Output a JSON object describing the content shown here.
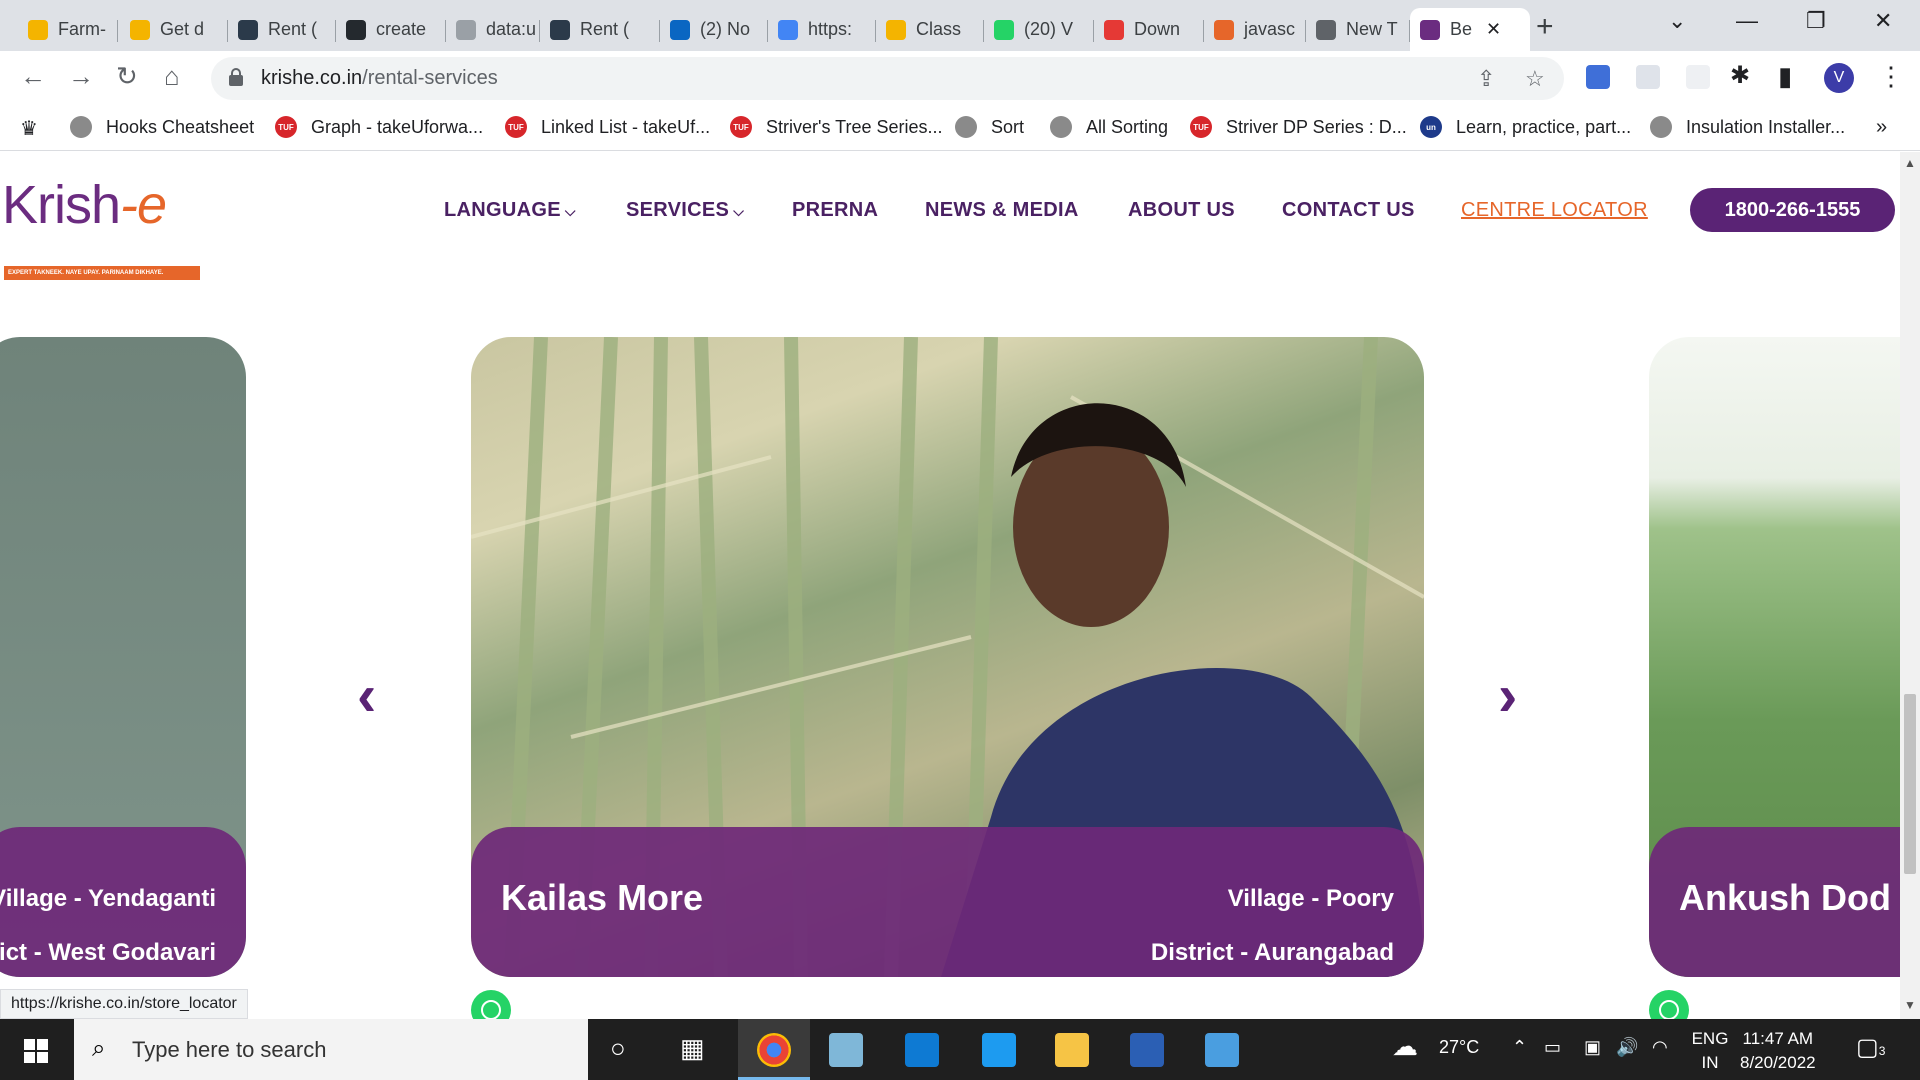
{
  "browser": {
    "tabs": [
      {
        "title": "Farm-",
        "color": "#f4b400"
      },
      {
        "title": "Get d",
        "color": "#f4b400"
      },
      {
        "title": "Rent (",
        "color": "#2b3a4a"
      },
      {
        "title": "create",
        "color": "#24292e"
      },
      {
        "title": "data:u",
        "color": "#9aa0a6"
      },
      {
        "title": "Rent (",
        "color": "#2b3a4a"
      },
      {
        "title": "(2) No",
        "color": "#0a66c2"
      },
      {
        "title": "https:",
        "color": "#4285f4"
      },
      {
        "title": "Class",
        "color": "#f4b400"
      },
      {
        "title": "(20) V",
        "color": "#25d366"
      },
      {
        "title": "Down",
        "color": "#e53935"
      },
      {
        "title": "javasc",
        "color": "#e6662a"
      },
      {
        "title": "New T",
        "color": "#5f6368"
      },
      {
        "title": "Be",
        "color": "#6b2c80"
      }
    ],
    "url_host": "krishe.co.in",
    "url_path": "/rental-services",
    "avatar_letter": "V",
    "bookmarks": [
      {
        "label": "Hooks Cheatsheet",
        "badge": ""
      },
      {
        "label": "Graph - takeUforwa...",
        "badge": "TUF"
      },
      {
        "label": "Linked List - takeUf...",
        "badge": "TUF"
      },
      {
        "label": "Striver's Tree Series...",
        "badge": "TUF"
      },
      {
        "label": "Sort",
        "badge": ""
      },
      {
        "label": "All Sorting",
        "badge": ""
      },
      {
        "label": "Striver DP Series : D...",
        "badge": "TUF"
      },
      {
        "label": "Learn, practice, part...",
        "badge": "un"
      },
      {
        "label": "Insulation Installer...",
        "badge": ""
      }
    ],
    "status_url": "https://krishe.co.in/store_locator"
  },
  "site": {
    "logo_text": "Krish-e",
    "logo_tagline": "EXPERT TAKNEEK. NAYE UPAY. PARINAAM DIKHAYE.",
    "nav": [
      "LANGUAGE",
      "SERVICES",
      "PRERNA",
      "NEWS & MEDIA",
      "ABOUT US",
      "CONTACT US",
      "CENTRE LOCATOR"
    ],
    "phone": "1800-266-1555",
    "brand_color": "#5a2375",
    "accent_color": "#e6662a"
  },
  "carousel": {
    "left_card": {
      "village": "Village - Yendaganti",
      "district": "District - West Godavari"
    },
    "center_card": {
      "name": "Kailas More",
      "village": "Village - Poory",
      "district": "District - Aurangabad"
    },
    "right_card": {
      "name": "Ankush Dod"
    },
    "prev_icon": "chevron-left",
    "next_icon": "chevron-right"
  },
  "taskbar": {
    "search_placeholder": "Type here to search",
    "weather": "27°C",
    "lang_top": "ENG",
    "lang_bottom": "IN",
    "time": "11:47 AM",
    "date": "8/20/2022",
    "notifications": "3"
  }
}
